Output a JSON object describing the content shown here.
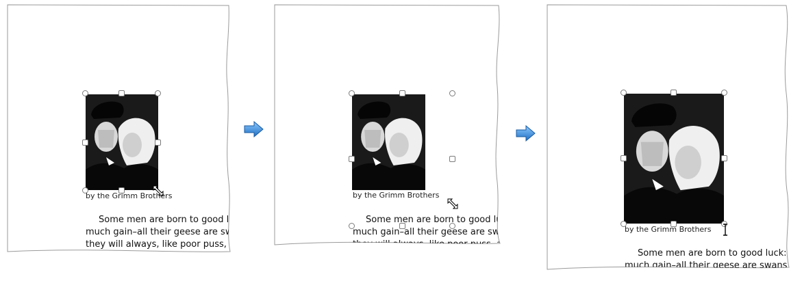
{
  "caption": "by the Grimm Brothers",
  "story_lines": [
    "Some men are born to good luck:",
    "much gain–all their geese are swans",
    "they will always, like poor puss, a"
  ],
  "colors": {
    "arrow": "#2f87d9",
    "handle_border": "#7a7a7a",
    "photo_dark": "#111111"
  },
  "cursors": [
    "resize-diagonal-icon",
    "resize-diagonal-icon",
    "text-cursor-icon"
  ]
}
